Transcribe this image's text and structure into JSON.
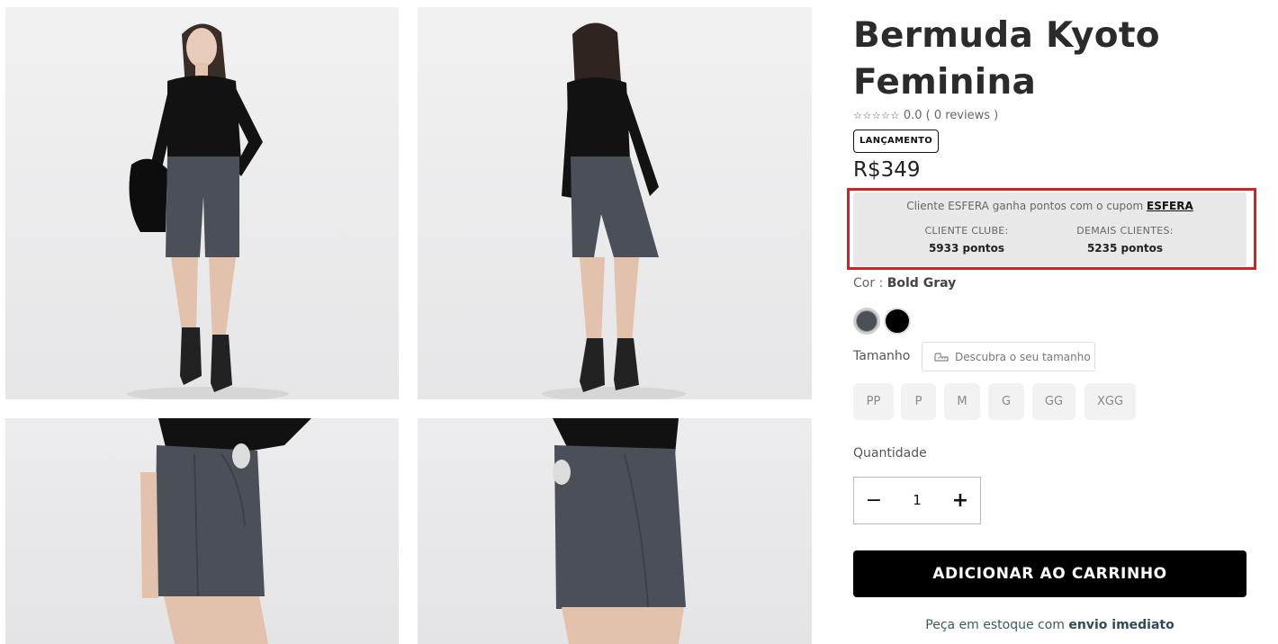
{
  "gallery": [
    {
      "name": "product-photo-front"
    },
    {
      "name": "product-photo-back"
    },
    {
      "name": "product-photo-side-detail"
    },
    {
      "name": "product-photo-back-detail"
    }
  ],
  "product": {
    "title": "Bermuda Kyoto Feminina",
    "stars_icon": "☆☆☆☆☆",
    "rating_text": "0.0 ( 0 reviews )",
    "badge": "LANÇAMENTO",
    "price": "R$349"
  },
  "esfera": {
    "intro": "Cliente ESFERA ganha pontos com o cupom",
    "coupon": "ESFERA",
    "clube_label": "CLIENTE CLUBE:",
    "clube_value": "5933 pontos",
    "demais_label": "DEMAIS CLIENTES:",
    "demais_value": "5235 pontos",
    "outline_color": "#d71f26"
  },
  "color": {
    "label": "Cor :",
    "selected": "Bold Gray",
    "swatches": [
      {
        "name": "Bold Gray",
        "hex": "#4b4f57"
      },
      {
        "name": "Preto",
        "hex": "#000000"
      }
    ]
  },
  "size": {
    "label": "Tamanho",
    "guide_icon": "ruler-icon",
    "guide_label": "Descubra o seu tamanho",
    "options": [
      "PP",
      "P",
      "M",
      "G",
      "GG",
      "XGG"
    ]
  },
  "quantity": {
    "label": "Quantidade",
    "minus_icon": "−",
    "value": "1",
    "plus_icon": "+"
  },
  "cart": {
    "button_label": "ADICIONAR AO CARRINHO"
  },
  "stock": {
    "prefix": "Peça em estoque com",
    "highlight": "envio imediato"
  }
}
